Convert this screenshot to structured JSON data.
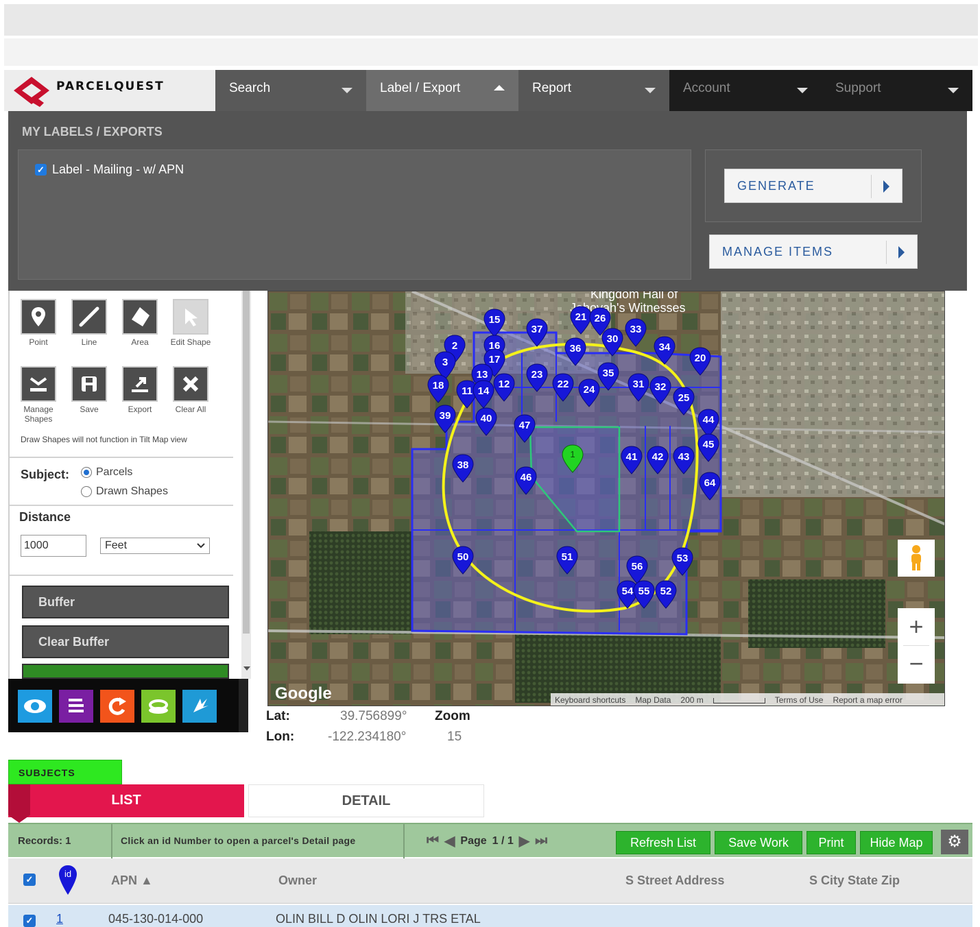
{
  "header": {
    "brand": "PARCELQUEST",
    "nav": [
      {
        "label": "Search",
        "state": "collapsed"
      },
      {
        "label": "Label / Export",
        "state": "expanded"
      },
      {
        "label": "Report",
        "state": "collapsed"
      },
      {
        "label": "Account",
        "state": "collapsed"
      },
      {
        "label": "Support",
        "state": "collapsed"
      }
    ]
  },
  "dropdown": {
    "title": "MY LABELS / EXPORTS",
    "items": [
      {
        "label": "Label - Mailing - w/ APN",
        "checked": true
      }
    ],
    "generate_label": "GENERATE",
    "manage_label": "MANAGE ITEMS"
  },
  "tools": {
    "row1": [
      "Point",
      "Line",
      "Area",
      "Edit Shape"
    ],
    "row2": [
      "Manage Shapes",
      "Save",
      "Export",
      "Clear All"
    ],
    "note": "Draw Shapes will not function in Tilt Map view"
  },
  "subject": {
    "label": "Subject:",
    "options": [
      "Parcels",
      "Drawn Shapes"
    ],
    "selected": "Parcels"
  },
  "distance": {
    "label": "Distance",
    "value": "1000",
    "unit": "Feet"
  },
  "buttons": {
    "buffer": "Buffer",
    "clear_buffer": "Clear Buffer"
  },
  "map": {
    "poi_label_1": "Kingdom Hall of",
    "poi_label_2": "Jehovah's Witnesses",
    "google": "Google",
    "attrib": [
      "Keyboard shortcuts",
      "Map Data",
      "200 m",
      "Terms of Use",
      "Report a map error"
    ],
    "zoom_in": "+",
    "zoom_out": "−",
    "markers": [
      "15",
      "37",
      "21",
      "26",
      "33",
      "2",
      "16",
      "36",
      "34",
      "3",
      "17",
      "30",
      "20",
      "23",
      "13",
      "35",
      "12",
      "22",
      "24",
      "31",
      "32",
      "18",
      "11",
      "14",
      "25",
      "39",
      "40",
      "47",
      "44",
      "45",
      "38",
      "41",
      "42",
      "43",
      "46",
      "64",
      "50",
      "51",
      "56",
      "53",
      "54",
      "55",
      "52",
      "1"
    ]
  },
  "coords": {
    "lat_label": "Lat:",
    "lat": "39.756899°",
    "lon_label": "Lon:",
    "lon": "-122.234180°",
    "zoom_label": "Zoom",
    "zoom": "15"
  },
  "tabs": {
    "subjects": "SUBJECTS",
    "list": "LIST",
    "detail": "DETAIL"
  },
  "grid_toolbar": {
    "records": "Records: 1",
    "hint": "Click an id Number to open a parcel's Detail page",
    "page_label": "Page",
    "page": "1 / 1",
    "refresh": "Refresh List",
    "save": "Save Work",
    "print": "Print",
    "hide_map": "Hide Map"
  },
  "grid": {
    "columns": [
      "APN",
      "Owner",
      "S Street Address",
      "S City State Zip"
    ],
    "id_header": "id",
    "rows": [
      {
        "id": "1",
        "apn": "045-130-014-000",
        "owner": "OLIN BILL D OLIN LORI J TRS ETAL",
        "street": "",
        "city": ""
      }
    ]
  },
  "colors": {
    "accent_red": "#e3164d",
    "subjects_green": "#2ee820",
    "grid_green": "#9fc89c",
    "marker_blue": "#1717d8",
    "subject_marker": "#22d422"
  }
}
